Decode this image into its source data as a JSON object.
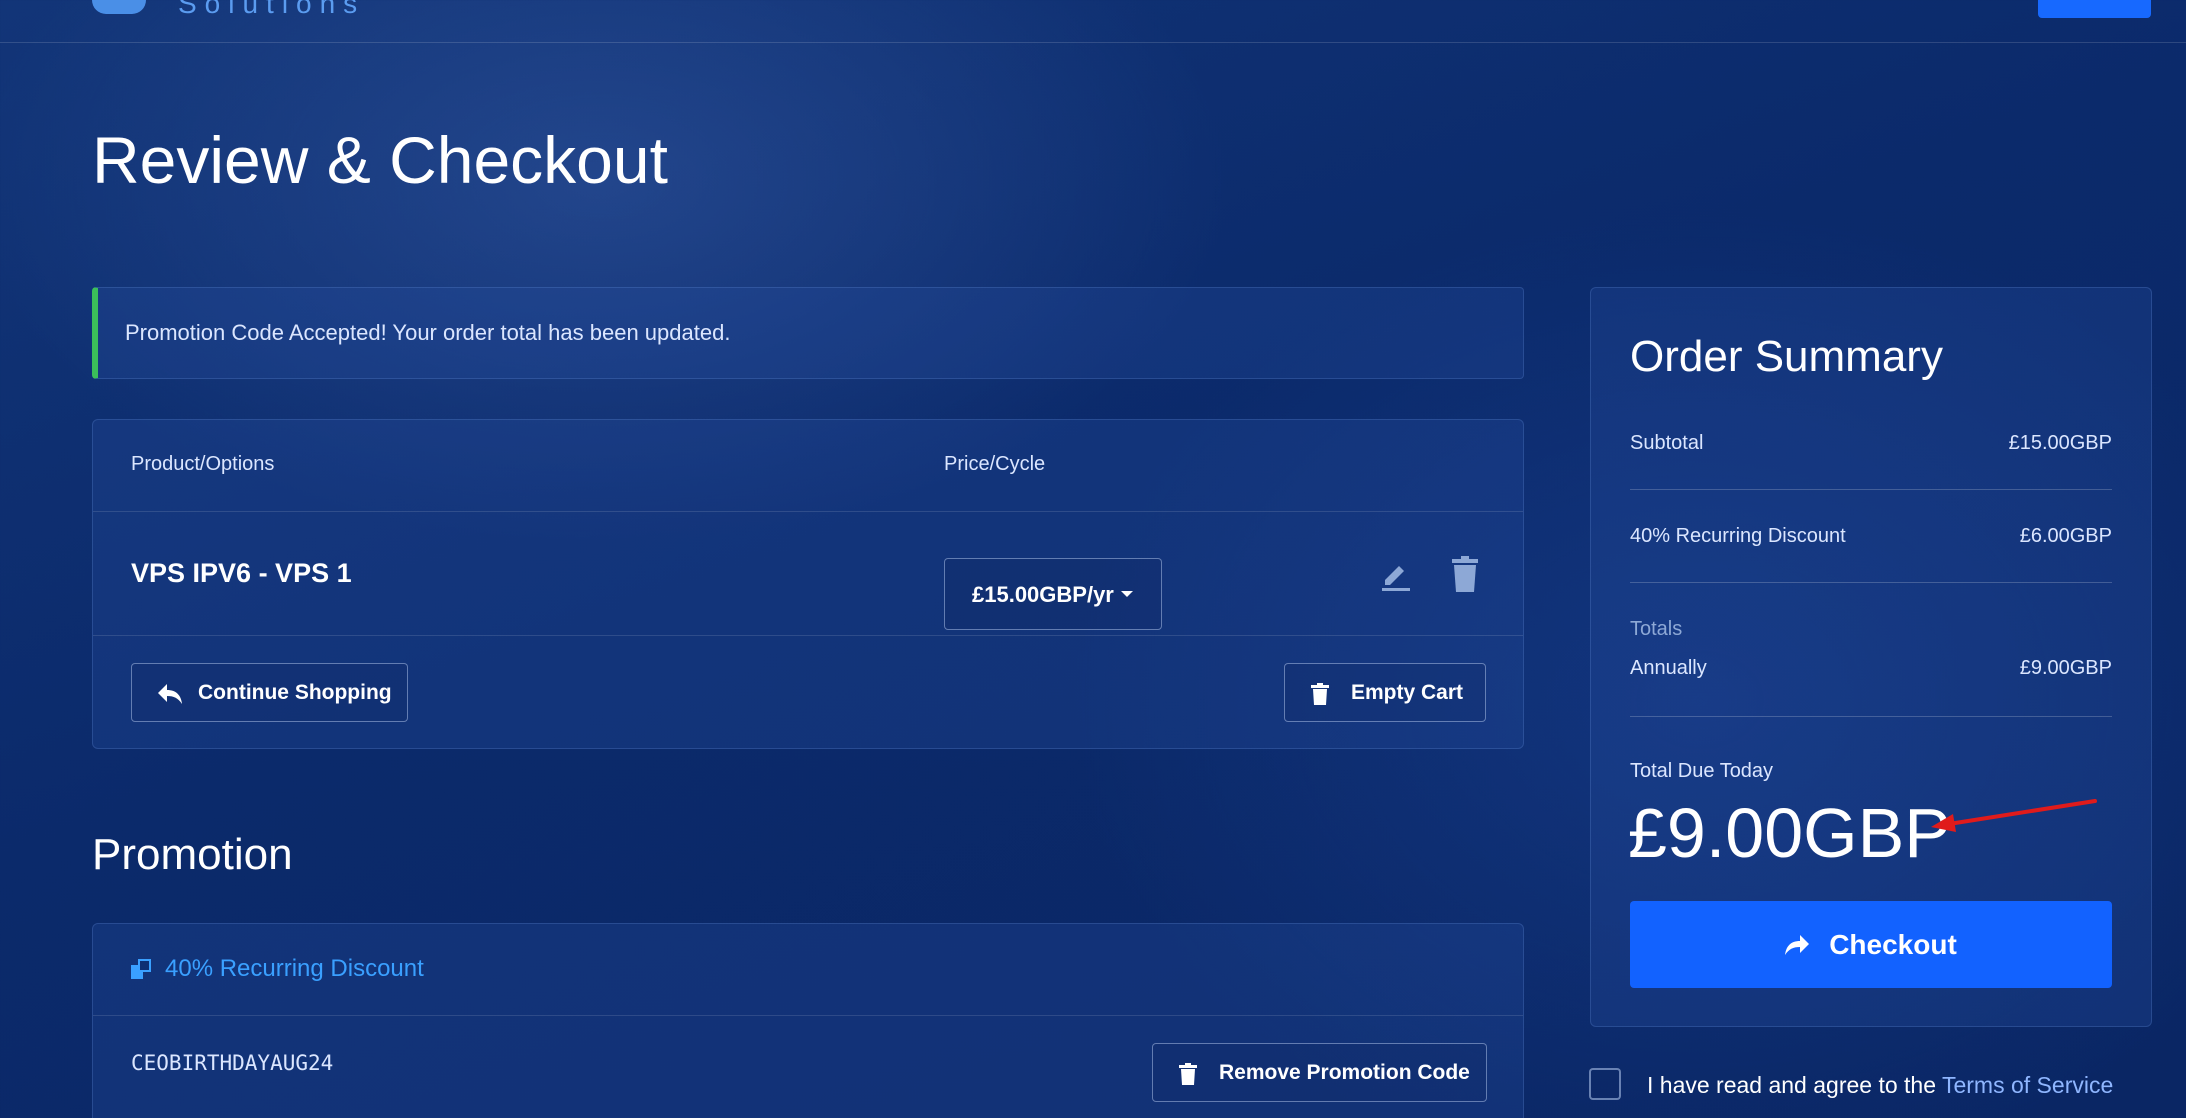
{
  "header": {
    "logo_text": "Solutions"
  },
  "page": {
    "title": "Review & Checkout"
  },
  "alert": {
    "message": "Promotion Code Accepted! Your order total has been updated."
  },
  "cart": {
    "columns": [
      "Product/Options",
      "Price/Cycle"
    ],
    "items": [
      {
        "name": "VPS IPV6 - VPS 1",
        "price_cycle": "£15.00GBP/yr"
      }
    ],
    "continue_label": "Continue Shopping",
    "empty_label": "Empty Cart"
  },
  "promotion": {
    "heading": "Promotion",
    "discount_label": "40% Recurring Discount",
    "code": "CEOBIRTHDAYAUG24",
    "remove_label": "Remove Promotion Code"
  },
  "summary": {
    "title": "Order Summary",
    "rows": [
      {
        "label": "Subtotal",
        "value": "£15.00GBP"
      },
      {
        "label": "40% Recurring Discount",
        "value": "£6.00GBP"
      }
    ],
    "totals_label": "Totals",
    "annual": {
      "label": "Annually",
      "value": "£9.00GBP"
    },
    "due_label": "Total Due Today",
    "due_amount": "£9.00GBP",
    "checkout_label": "Checkout"
  },
  "tos": {
    "text": "I have read and agree to the",
    "link": "Terms of Service"
  },
  "colors": {
    "accent": "#1262ff",
    "success": "#3bbf5a",
    "link": "#3aa0ff",
    "annotation": "#e01b1b"
  }
}
